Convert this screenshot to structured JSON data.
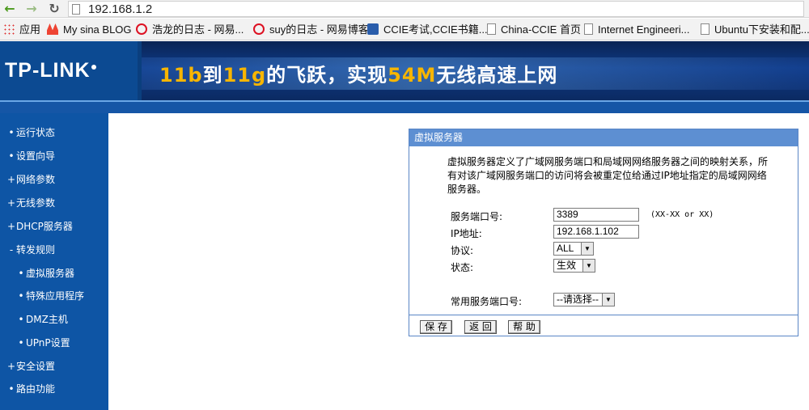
{
  "browser": {
    "url": "192.168.1.2",
    "bookmarks": [
      "应用",
      "My sina BLOG",
      "浩龙的日志 - 网易...",
      "suy的日志 - 网易博客",
      "CCIE考试,CCIE书籍...",
      "China-CCIE 首页",
      "Internet Engineeri...",
      "Ubuntu下安装和配..."
    ]
  },
  "header": {
    "logo": "TP-LINK",
    "banner_parts": [
      "11b",
      "到",
      "11g",
      "的飞跃，实现",
      "54M",
      "无线高速上网"
    ]
  },
  "sidebar": {
    "items": [
      "运行状态",
      "设置向导",
      "网络参数",
      "无线参数",
      "DHCP服务器",
      "转发规则",
      "虚拟服务器",
      "特殊应用程序",
      "DMZ主机",
      "UPnP设置",
      "安全设置",
      "路由功能"
    ],
    "bullets": [
      "•",
      "•",
      "+",
      "+",
      "+",
      "-",
      "•",
      "•",
      "•",
      "•",
      "+",
      "•"
    ]
  },
  "panel": {
    "title": "虚拟服务器",
    "description": "虚拟服务器定义了广域网服务端口和局域网网络服务器之间的映射关系，所有对该广域网服务端口的访问将会被重定位给通过IP地址指定的局域网网络服务器。",
    "fields": {
      "port_label": "服务端口号:",
      "port_value": "3389",
      "port_hint": "(XX-XX or XX)",
      "ip_label": "IP地址:",
      "ip_value": "192.168.1.102",
      "protocol_label": "协议:",
      "protocol_value": "ALL",
      "status_label": "状态:",
      "status_value": "生效",
      "common_port_label": "常用服务端口号:",
      "common_port_value": "--请选择--"
    },
    "buttons": {
      "save": "保 存",
      "back": "返 回",
      "help": "帮 助"
    }
  }
}
